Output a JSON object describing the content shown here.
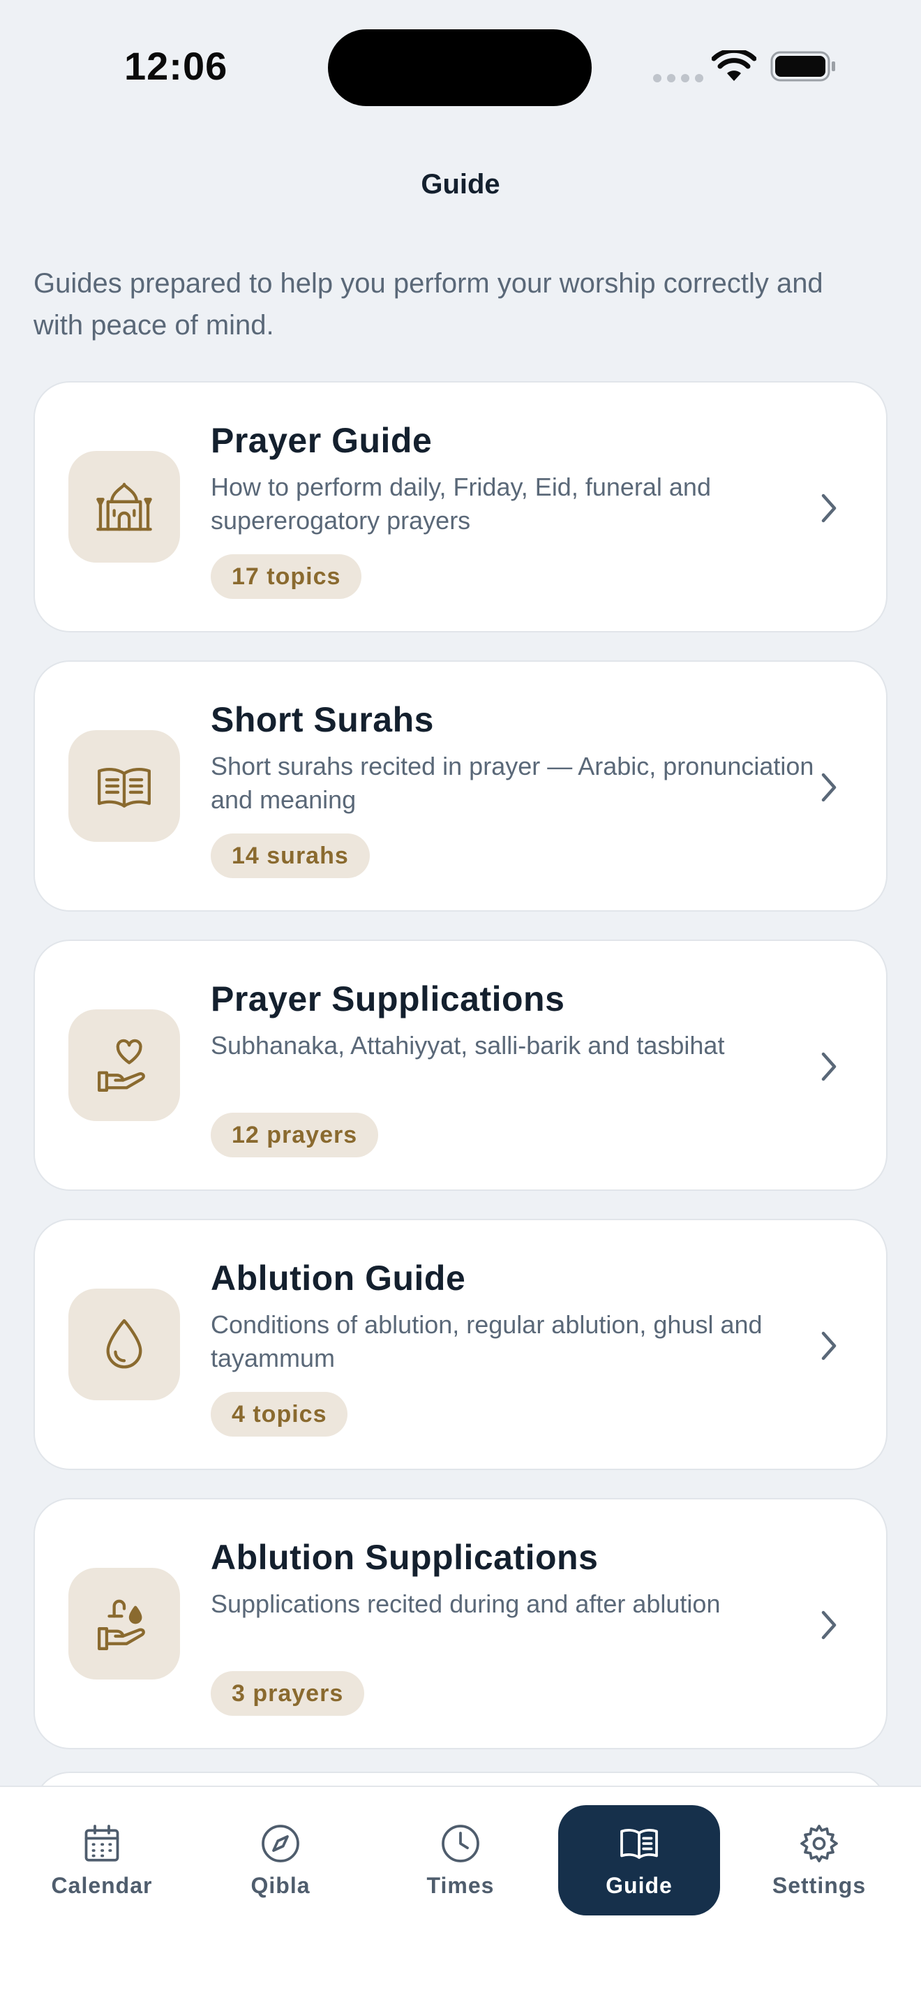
{
  "status_bar": {
    "time": "12:06"
  },
  "header": {
    "title": "Guide",
    "intro": "Guides prepared to help you perform your worship correctly and with peace of mind."
  },
  "colors": {
    "accent": "#16304B",
    "icon_gold": "#8A6A2F",
    "icon_bg": "#EDE6DC",
    "background": "#EEF1F5"
  },
  "cards": [
    {
      "icon": "mosque-icon",
      "title": "Prayer Guide",
      "description": "How to perform daily, Friday, Eid, funeral and supererogatory prayers",
      "badge": "17 topics"
    },
    {
      "icon": "open-book-icon",
      "title": "Short Surahs",
      "description": "Short surahs recited in prayer — Arabic, pronunciation and meaning",
      "badge": "14 surahs"
    },
    {
      "icon": "hand-heart-icon",
      "title": "Prayer Supplications",
      "description": "Subhanaka, Attahiyyat, salli-barik and tasbihat",
      "badge": "12 prayers"
    },
    {
      "icon": "water-drop-icon",
      "title": "Ablution Guide",
      "description": "Conditions of ablution, regular ablution, ghusl and tayammum",
      "badge": "4 topics"
    },
    {
      "icon": "hand-water-icon",
      "title": "Ablution Supplications",
      "description": "Supplications recited during and after ablution",
      "badge": "3 prayers"
    }
  ],
  "tabs": [
    {
      "label": "Calendar",
      "icon": "calendar-icon",
      "active": false
    },
    {
      "label": "Qibla",
      "icon": "compass-icon",
      "active": false
    },
    {
      "label": "Times",
      "icon": "clock-icon",
      "active": false
    },
    {
      "label": "Guide",
      "icon": "book-icon",
      "active": true
    },
    {
      "label": "Settings",
      "icon": "gear-icon",
      "active": false
    }
  ]
}
